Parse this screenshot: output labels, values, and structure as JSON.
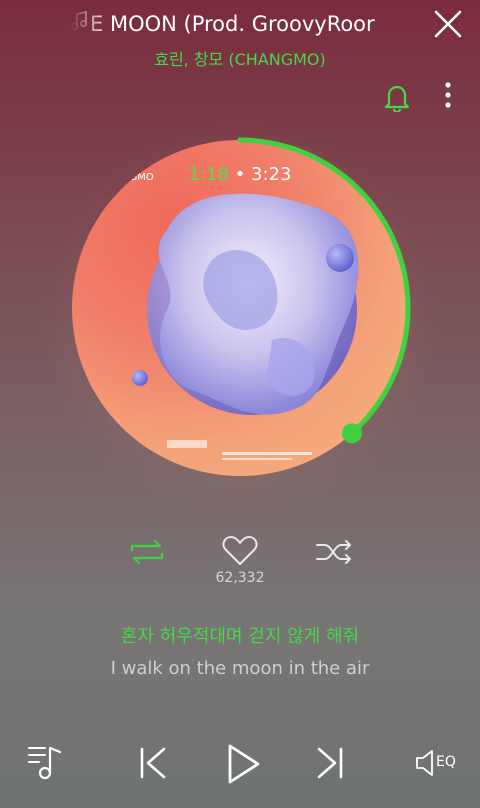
{
  "player": {
    "title": "FLY ME TO THE MOON (Prod. GroovyRoom)",
    "title_visible": "E MOON (Prod. GroovyRoor",
    "artist": "효린, 창모 (CHANGMO)",
    "current_time": "1:18",
    "separator": "•",
    "total_time": "3:23",
    "progress_fraction": 0.384,
    "cover_label": "NGMO",
    "like_count": "62,332",
    "lyric_current": "혼자 허우적대며 걷지 않게 해줘",
    "lyric_translation": "I walk on the moon in the air",
    "eq_label": "EQ"
  },
  "colors": {
    "accent": "#3fd13f",
    "text_muted": "#cfcfcf"
  },
  "icons": {
    "title_note": "music-note-icon",
    "close": "close-icon",
    "bell": "bell-icon",
    "more": "more-vertical-icon",
    "repeat": "repeat-icon",
    "like": "heart-icon",
    "shuffle": "shuffle-icon",
    "playlist": "playlist-icon",
    "previous": "previous-icon",
    "play": "play-icon",
    "next": "next-icon",
    "equalizer": "equalizer-icon"
  }
}
